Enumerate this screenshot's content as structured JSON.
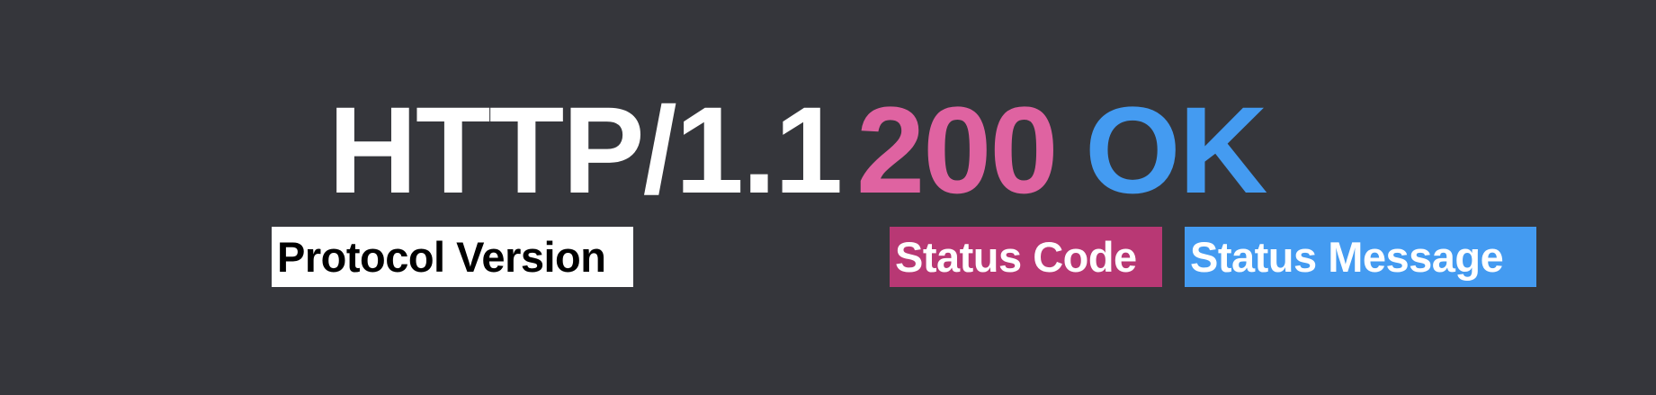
{
  "status_line": {
    "protocol": "HTTP/1.1",
    "code": "200",
    "message": "OK"
  },
  "labels": {
    "protocol": "Protocol Version",
    "code": "Status Code",
    "message": "Status Message"
  },
  "colors": {
    "background": "#35363b",
    "protocol_text": "#ffffff",
    "code_text": "#df63a1",
    "message_text": "#449bf1",
    "protocol_label_bg": "#ffffff",
    "code_label_bg": "#b83874",
    "message_label_bg": "#449bf1"
  }
}
